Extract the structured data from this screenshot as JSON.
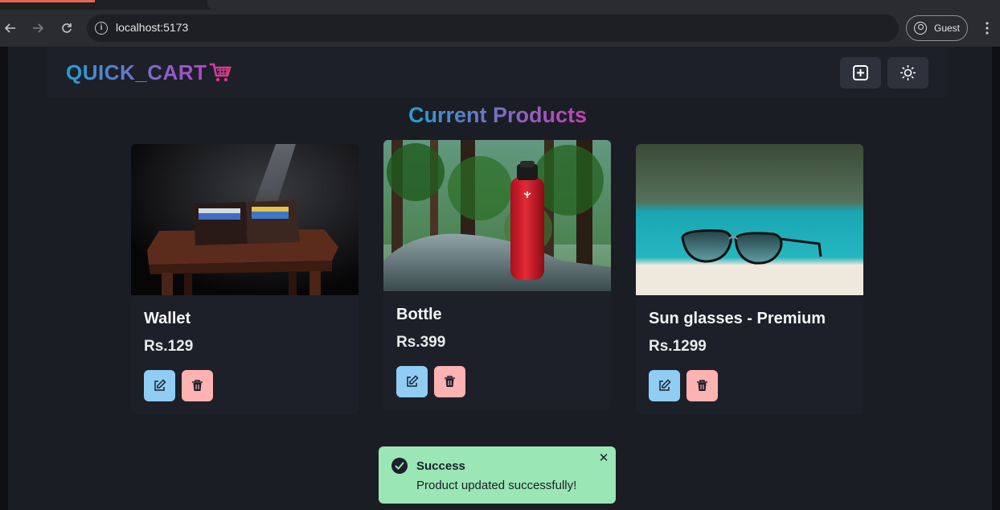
{
  "browser": {
    "url": "localhost:5173",
    "profile_label": "Guest"
  },
  "app": {
    "logo_text": "QUICK_CART",
    "section_title": "Current Products"
  },
  "products": [
    {
      "name": "Wallet",
      "price": "Rs.129"
    },
    {
      "name": "Bottle",
      "price": "Rs.399"
    },
    {
      "name": "Sun glasses - Premium",
      "price": "Rs.1299"
    }
  ],
  "toast": {
    "title": "Success",
    "message": "Product updated successfully!",
    "close_symbol": "✕",
    "color": "#9ae6b4"
  },
  "colors": {
    "edit_button": "#90cdf4",
    "delete_button": "#feb2b2",
    "brand_gradient_start": "#24a0d3",
    "brand_gradient_end": "#b347c7"
  },
  "icons": {
    "back": "arrow-left-icon",
    "forward": "arrow-right-icon",
    "reload": "reload-icon",
    "site_info": "info-icon",
    "profile": "account-icon",
    "menu": "kebab-menu-icon",
    "cart": "shopping-cart-icon",
    "add": "plus-square-icon",
    "theme": "sun-icon",
    "edit": "edit-icon",
    "delete": "trash-icon",
    "success": "check-circle-icon",
    "close": "close-icon"
  }
}
